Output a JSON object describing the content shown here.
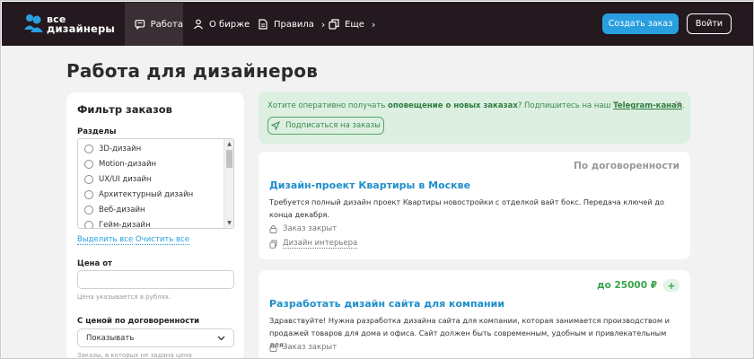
{
  "header": {
    "logo_top": "все",
    "logo_bottom": "дизайнеры",
    "nav": [
      {
        "label": "Работа",
        "icon": "chat-icon"
      },
      {
        "label": "О бирже",
        "icon": "person-icon"
      },
      {
        "label": "Правила",
        "icon": "document-icon"
      },
      {
        "label": "Еще",
        "icon": "copy-icon"
      }
    ],
    "create_order_label": "Создать заказ",
    "login_label": "Войти",
    "accent_color": "#2a9fe0",
    "bg_color": "#23191f"
  },
  "page": {
    "title": "Работа для дизайнеров"
  },
  "filter": {
    "title": "Фильтр заказов",
    "sections_label": "Разделы",
    "sections": [
      "3D-дизайн",
      "Motion-дизайн",
      "UX/UI дизайн",
      "Архитектурный дизайн",
      "Веб-дизайн",
      "Гейм-дизайн"
    ],
    "select_all": "Выделить все",
    "clear_all": "Очистить все",
    "price_from_label": "Цена от",
    "price_from_value": "",
    "price_hint": "Цена указывается в рублях.",
    "negotiable_label": "С ценой по договоренности",
    "negotiable_value": "Показывать",
    "negotiable_hint": "Заказы, в которых не задана цена"
  },
  "notice": {
    "text_before": "Хотите оперативно получать ",
    "text_bold": "оповещение о новых заказах",
    "text_middle": "? Подпишитесь на наш ",
    "telegram_link": "Telegram-канал",
    "text_after": ".",
    "subscribe_label": "Подписаться на заказы",
    "close_symbol": "×"
  },
  "jobs": [
    {
      "price": "По договоренности",
      "title": "Дизайн-проект Квартиры в Москве",
      "description": "Требуется полный дизайн проект Квартиры новостройки с отделкой вайт бокс. Передача ключей до конца декабря.",
      "status": "Заказ закрыт",
      "category": "Дизайн интерьера"
    },
    {
      "price": "до 25000 ₽",
      "plus": "+",
      "title": "Разработать дизайн сайта для компании",
      "description": "Здравствуйте! Нужна разработка дизайна сайта для компании, которая занимается производством и продажей товаров для дома и офиса. Сайт должен быть современным, удобным и привлекательным для...",
      "status": "Заказ закрыт"
    }
  ]
}
